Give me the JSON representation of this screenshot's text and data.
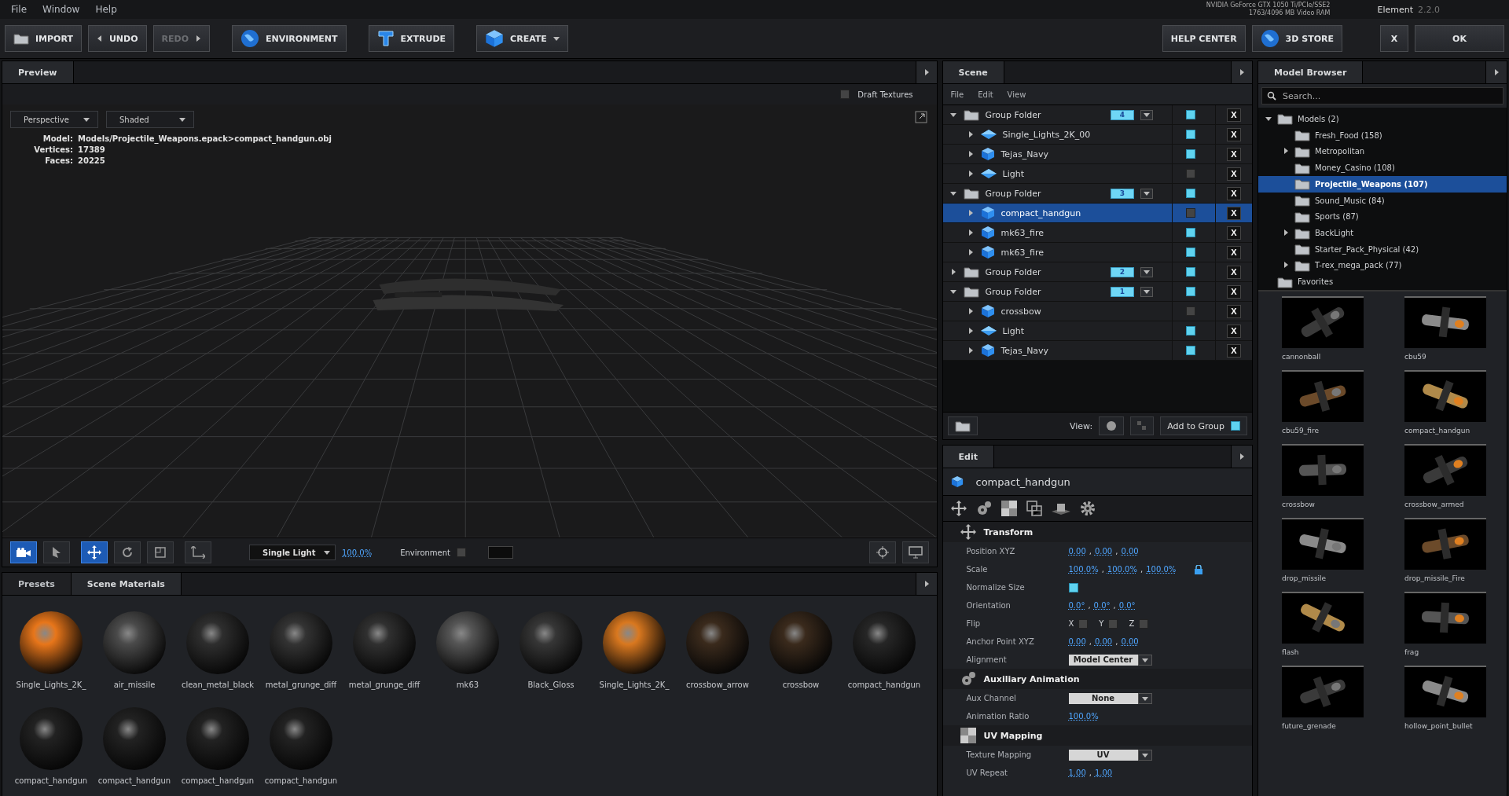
{
  "menu": [
    "File",
    "Window",
    "Help"
  ],
  "gpu": {
    "name": "NVIDIA GeForce GTX 1050 Ti/PCIe/SSE2",
    "memory": "1763/4096 MB Video RAM"
  },
  "app": {
    "name": "Element",
    "version": "2.2.0"
  },
  "toolbar": [
    {
      "label": "IMPORT",
      "disabled": false
    },
    {
      "label": "UNDO",
      "disabled": false
    },
    {
      "label": "REDO",
      "disabled": true
    },
    {
      "label": "ENVIRONMENT",
      "disabled": false
    },
    {
      "label": "EXTRUDE",
      "disabled": false
    },
    {
      "label": "CREATE",
      "disabled": false
    }
  ],
  "toolbar_right": [
    {
      "label": "HELP CENTER"
    },
    {
      "label": "3D STORE"
    },
    {
      "label": "X"
    },
    {
      "label": "OK"
    }
  ],
  "preview": {
    "tab": "Preview",
    "draft_textures": {
      "label": "Draft Textures",
      "checked": false
    },
    "view_modes": [
      "Perspective",
      "Shaded"
    ],
    "info": [
      {
        "label": "Model:",
        "value": "Models/Projectile_Weapons.epack>compact_handgun.obj"
      },
      {
        "label": "Vertices:",
        "value": "17389"
      },
      {
        "label": "Faces:",
        "value": "20225"
      }
    ],
    "tools": [
      {
        "selected": true
      },
      {
        "selected": false
      },
      {
        "selected": true
      },
      {
        "selected": false
      },
      {
        "selected": false
      },
      {
        "selected": false
      }
    ],
    "light": "Single Light",
    "intensity": "100.0%",
    "environment": {
      "label": "Environment",
      "checked": false
    }
  },
  "materials": {
    "tabs": [
      {
        "label": "Presets",
        "selected": false
      },
      {
        "label": "Scene Materials",
        "selected": true
      }
    ],
    "items": [
      {
        "name": "Single_Lights_2K_",
        "color": "#e8761a"
      },
      {
        "name": "air_missile",
        "color": "#4a4a4a"
      },
      {
        "name": "clean_metal_black",
        "color": "#2e2e2e"
      },
      {
        "name": "metal_grunge_diff",
        "color": "#333333"
      },
      {
        "name": "metal_grunge_diff",
        "color": "#303030"
      },
      {
        "name": "mk63",
        "color": "#555555"
      },
      {
        "name": "Black_Gloss",
        "color": "#363636"
      },
      {
        "name": "Single_Lights_2K_",
        "color": "#d9781f"
      },
      {
        "name": "crossbow_arrow",
        "color": "#3a2a1c"
      },
      {
        "name": "crossbow",
        "color": "#3a2a1c"
      },
      {
        "name": "compact_handgun",
        "color": "#262626"
      },
      {
        "name": "compact_handgun",
        "color": "#222222"
      },
      {
        "name": "compact_handgun",
        "color": "#222222"
      },
      {
        "name": "compact_handgun",
        "color": "#222222"
      },
      {
        "name": "compact_handgun",
        "color": "#222222"
      }
    ]
  },
  "scene": {
    "tab": "Scene",
    "menu": [
      "File",
      "Edit",
      "View"
    ],
    "tree": [
      {
        "label": "Group Folder",
        "count": "4",
        "expanded": true,
        "visible": true,
        "selected": false,
        "children": [
          {
            "label": "Single_Lights_2K_00",
            "kind": "light",
            "visible": true,
            "selected": false,
            "delete": "X"
          },
          {
            "label": "Tejas_Navy",
            "kind": "mesh",
            "visible": true,
            "selected": false,
            "delete": "X"
          },
          {
            "label": "Light",
            "kind": "light",
            "visible": false,
            "selected": false,
            "delete": "X"
          }
        ],
        "delete": "X"
      },
      {
        "label": "Group Folder",
        "count": "3",
        "expanded": true,
        "visible": true,
        "selected": false,
        "delete": "X",
        "children": [
          {
            "label": "compact_handgun",
            "kind": "mesh",
            "visible": false,
            "selected": true,
            "delete": "X"
          },
          {
            "label": "mk63_fire",
            "kind": "mesh",
            "visible": true,
            "selected": false,
            "delete": "X"
          },
          {
            "label": "mk63_fire",
            "kind": "mesh",
            "visible": true,
            "selected": false,
            "delete": "X"
          }
        ]
      },
      {
        "label": "Group Folder",
        "count": "2",
        "expanded": false,
        "visible": true,
        "selected": false,
        "delete": "X"
      },
      {
        "label": "Group Folder",
        "count": "1",
        "expanded": true,
        "visible": true,
        "selected": false,
        "delete": "X",
        "children": [
          {
            "label": "crossbow",
            "kind": "mesh",
            "visible": false,
            "selected": false,
            "delete": "X"
          },
          {
            "label": "Light",
            "kind": "light",
            "visible": true,
            "selected": false,
            "delete": "X"
          },
          {
            "label": "Tejas_Navy",
            "kind": "mesh",
            "visible": true,
            "selected": false,
            "delete": "X"
          }
        ]
      }
    ],
    "view_label": "View:",
    "add_to_group": {
      "label": "Add to Group",
      "checked": true
    }
  },
  "edit": {
    "tab": "Edit",
    "object": "compact_handgun",
    "value_separator": ",",
    "sections": [
      {
        "title": "Transform",
        "rows": [
          {
            "label": "Position XYZ",
            "kind": "values",
            "values": [
              "0.00",
              "0.00",
              "0.00"
            ]
          },
          {
            "label": "Scale",
            "kind": "values",
            "values": [
              "100.0%",
              "100.0%",
              "100.0%"
            ],
            "locked": true
          },
          {
            "label": "Normalize Size",
            "kind": "checkbox",
            "checked": true
          },
          {
            "label": "Orientation",
            "kind": "values",
            "values": [
              "0.0°",
              "0.0°",
              "0.0°"
            ]
          },
          {
            "label": "Flip",
            "kind": "flip",
            "axes": [
              {
                "label": "X",
                "checked": false
              },
              {
                "label": "Y",
                "checked": false
              },
              {
                "label": "Z",
                "checked": false
              }
            ]
          },
          {
            "label": "Anchor Point XYZ",
            "kind": "values",
            "values": [
              "0.00",
              "0.00",
              "0.00"
            ]
          },
          {
            "label": "Alignment",
            "kind": "dropdown",
            "value": "Model Center"
          }
        ]
      },
      {
        "title": "Auxiliary Animation",
        "rows": [
          {
            "label": "Aux Channel",
            "kind": "dropdown",
            "value": "None"
          },
          {
            "label": "Animation Ratio",
            "kind": "values",
            "values": [
              "100.0%"
            ]
          }
        ]
      },
      {
        "title": "UV Mapping",
        "rows": [
          {
            "label": "Texture Mapping",
            "kind": "dropdown",
            "value": "UV"
          },
          {
            "label": "UV Repeat",
            "kind": "values",
            "values": [
              "1.00",
              "1.00"
            ]
          }
        ]
      }
    ]
  },
  "browser": {
    "tab": "Model Browser",
    "search": {
      "placeholder": "Search..."
    },
    "tree": [
      {
        "label": "Models (2)",
        "expanded": true,
        "selected": false,
        "children": [
          {
            "label": "Fresh_Food (158)",
            "selected": false
          },
          {
            "label": "Metropolitan",
            "expanded": false,
            "selected": false
          },
          {
            "label": "Money_Casino (108)",
            "selected": false
          },
          {
            "label": "Projectile_Weapons (107)",
            "selected": true
          },
          {
            "label": "Sound_Music (84)",
            "selected": false
          },
          {
            "label": "Sports (87)",
            "selected": false
          },
          {
            "label": "BackLight",
            "expanded": false,
            "selected": false
          },
          {
            "label": "Starter_Pack_Physical (42)",
            "selected": false
          },
          {
            "label": "T-rex_mega_pack (77)",
            "expanded": false,
            "selected": false
          }
        ]
      },
      {
        "label": "Favorites",
        "selected": false
      }
    ],
    "models": [
      "cannonball",
      "cbu59",
      "cbu59_fire",
      "compact_handgun",
      "crossbow",
      "crossbow_armed",
      "drop_missile",
      "drop_missile_Fire",
      "flash",
      "frag",
      "future_grenade",
      "hollow_point_bullet"
    ]
  }
}
